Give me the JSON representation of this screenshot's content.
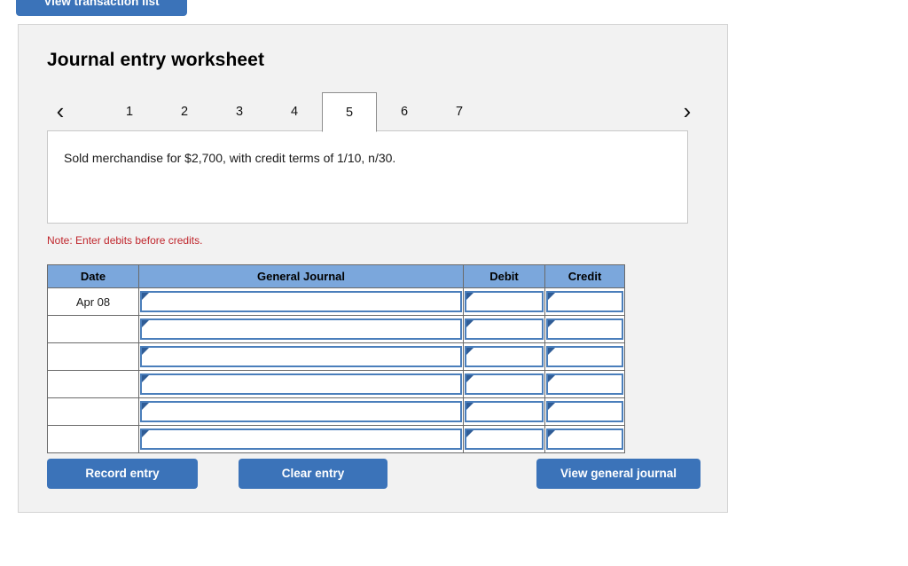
{
  "top_button": {
    "label": "View transaction list"
  },
  "panel": {
    "title": "Journal entry worksheet",
    "nav": {
      "prev_icon": "chevron-left-icon",
      "next_icon": "chevron-right-icon",
      "prev_glyph": "‹",
      "next_glyph": "›"
    },
    "tabs": [
      {
        "label": "1",
        "active": false
      },
      {
        "label": "2",
        "active": false
      },
      {
        "label": "3",
        "active": false
      },
      {
        "label": "4",
        "active": false
      },
      {
        "label": "5",
        "active": true
      },
      {
        "label": "6",
        "active": false
      },
      {
        "label": "7",
        "active": false
      }
    ],
    "description": "Sold merchandise for $2,700, with credit terms of 1/10, n/30.",
    "note": "Note: Enter debits before credits.",
    "table": {
      "headers": [
        "Date",
        "General Journal",
        "Debit",
        "Credit"
      ],
      "rows": [
        {
          "date": "Apr 08",
          "general_journal": "",
          "debit": "",
          "credit": ""
        },
        {
          "date": "",
          "general_journal": "",
          "debit": "",
          "credit": ""
        },
        {
          "date": "",
          "general_journal": "",
          "debit": "",
          "credit": ""
        },
        {
          "date": "",
          "general_journal": "",
          "debit": "",
          "credit": ""
        },
        {
          "date": "",
          "general_journal": "",
          "debit": "",
          "credit": ""
        },
        {
          "date": "",
          "general_journal": "",
          "debit": "",
          "credit": ""
        }
      ]
    },
    "buttons": {
      "record": "Record entry",
      "clear": "Clear entry",
      "view_journal": "View general journal"
    }
  },
  "colors": {
    "button_blue": "#3b73b9",
    "header_blue": "#7ba7dc",
    "input_border_blue": "#4a7ebb",
    "note_red": "#c0272d",
    "panel_gray": "#f2f2f2"
  }
}
